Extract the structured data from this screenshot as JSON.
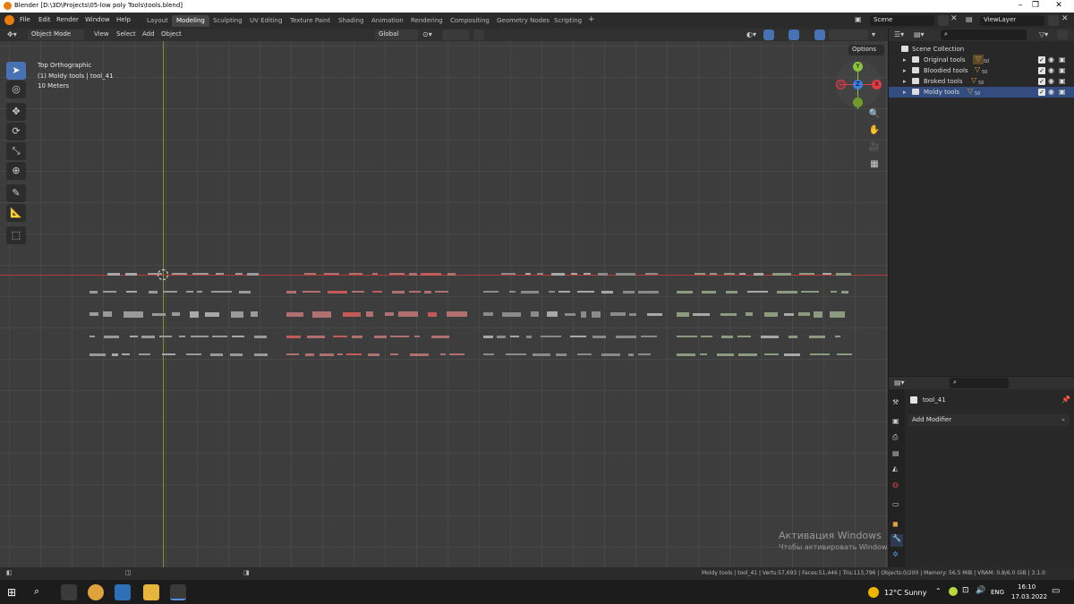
{
  "window": {
    "title": "Blender [D:\\3D\\Projects\\05-low poly Tools\\tools.blend]",
    "controls": [
      "–",
      "❐",
      "✕"
    ]
  },
  "menu": [
    "File",
    "Edit",
    "Render",
    "Window",
    "Help"
  ],
  "workspaces": [
    "Layout",
    "Modeling",
    "Sculpting",
    "UV Editing",
    "Texture Paint",
    "Shading",
    "Animation",
    "Rendering",
    "Compositing",
    "Geometry Nodes",
    "Scripting"
  ],
  "active_workspace": "Modeling",
  "add_workspace": "+",
  "scene": {
    "name": "Scene",
    "view_layer": "ViewLayer"
  },
  "viewport_header": {
    "mode": "Object Mode",
    "menus": [
      "View",
      "Select",
      "Add",
      "Object"
    ],
    "transform_orientation": "Global",
    "options": "Options"
  },
  "viewport_overlay": {
    "view_name": "Top Orthographic",
    "collection_object": "(1) Moldy tools | tool_41",
    "scale": "10 Meters"
  },
  "gizmo": {
    "y": "Y",
    "x": "X",
    "z": "Z"
  },
  "outliner": {
    "root": "Scene Collection",
    "collections": [
      {
        "name": "Original tools",
        "count": "50"
      },
      {
        "name": "Bloodied tools",
        "count": "50"
      },
      {
        "name": "Broked tools",
        "count": "50"
      },
      {
        "name": "Moldy tools",
        "count": "50"
      }
    ]
  },
  "properties": {
    "object_name": "tool_41",
    "add_modifier": "Add Modifier"
  },
  "statusbar": {
    "stats": "Moldy tools | tool_41 | Verts:57,693 | Faces:51,446 | Tris:113,796 | Objects:0/200 | Memory: 56.5 MiB | VRAM: 0.8/6.0 GiB | 3.1.0"
  },
  "watermark": {
    "line1": "Активация Windows",
    "line2": "Чтобы активировать Windows, перейдите в раздел \"Параметры\"."
  },
  "taskbar": {
    "weather": "12°C  Sunny",
    "language": "ENG",
    "time": "16:10",
    "date": "17.03.2022"
  },
  "colors": {
    "accent": "#4772b3",
    "active_tab": "#444444",
    "viewport_bg": "#3d3d3d",
    "x_axis": "#b83a3a",
    "y_axis": "#6f9a2e",
    "gizmo_x": "#e03c48",
    "gizmo_y": "#8ac43a",
    "gizmo_z": "#3c7ee0",
    "collection_icon": "#e0a23c"
  }
}
